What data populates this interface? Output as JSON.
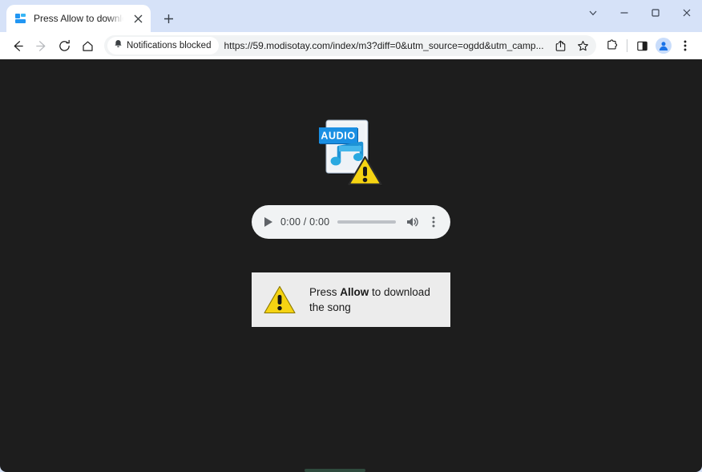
{
  "window": {
    "controls": [
      {
        "name": "tab-search",
        "icon": "chevron-down-icon"
      },
      {
        "name": "minimize",
        "icon": "minimize-icon"
      },
      {
        "name": "maximize",
        "icon": "maximize-icon"
      },
      {
        "name": "close",
        "icon": "close-icon"
      }
    ]
  },
  "tabstrip": {
    "tab": {
      "title": "Press Allow to download the so",
      "favicon": "browser-page-favicon",
      "close_label": "×"
    },
    "new_tab_label": "+"
  },
  "toolbar": {
    "back": "back-arrow-icon",
    "forward": "forward-arrow-icon",
    "reload": "reload-icon",
    "home": "home-icon",
    "permission_chip": {
      "icon": "bell-blocked-icon",
      "label": "Notifications blocked"
    },
    "url": "https://59.modisotay.com/index/m3?diff=0&utm_source=ogdd&utm_camp...",
    "share": "share-icon",
    "bookmark": "star-icon",
    "extensions": "puzzle-piece-icon",
    "split_view": "split-view-icon",
    "profile": "profile-avatar-icon",
    "menu": "three-dot-menu-icon"
  },
  "page": {
    "background_color": "#1d1d1d",
    "file_icon": {
      "badge": "AUDIO",
      "name": "audio-file-warning-icon",
      "badge_color": "#1a8fe3",
      "note_color": "#29a8e0",
      "warning_color": "#f5d312"
    },
    "player": {
      "play_label": "play-button",
      "timecode": "0:00 / 0:00",
      "volume_label": "volume-button",
      "menu_label": "more-options-button"
    },
    "notice": {
      "warning_color": "#f5d312",
      "text_before": "Press ",
      "text_bold": "Allow",
      "text_after": " to download the song"
    }
  }
}
